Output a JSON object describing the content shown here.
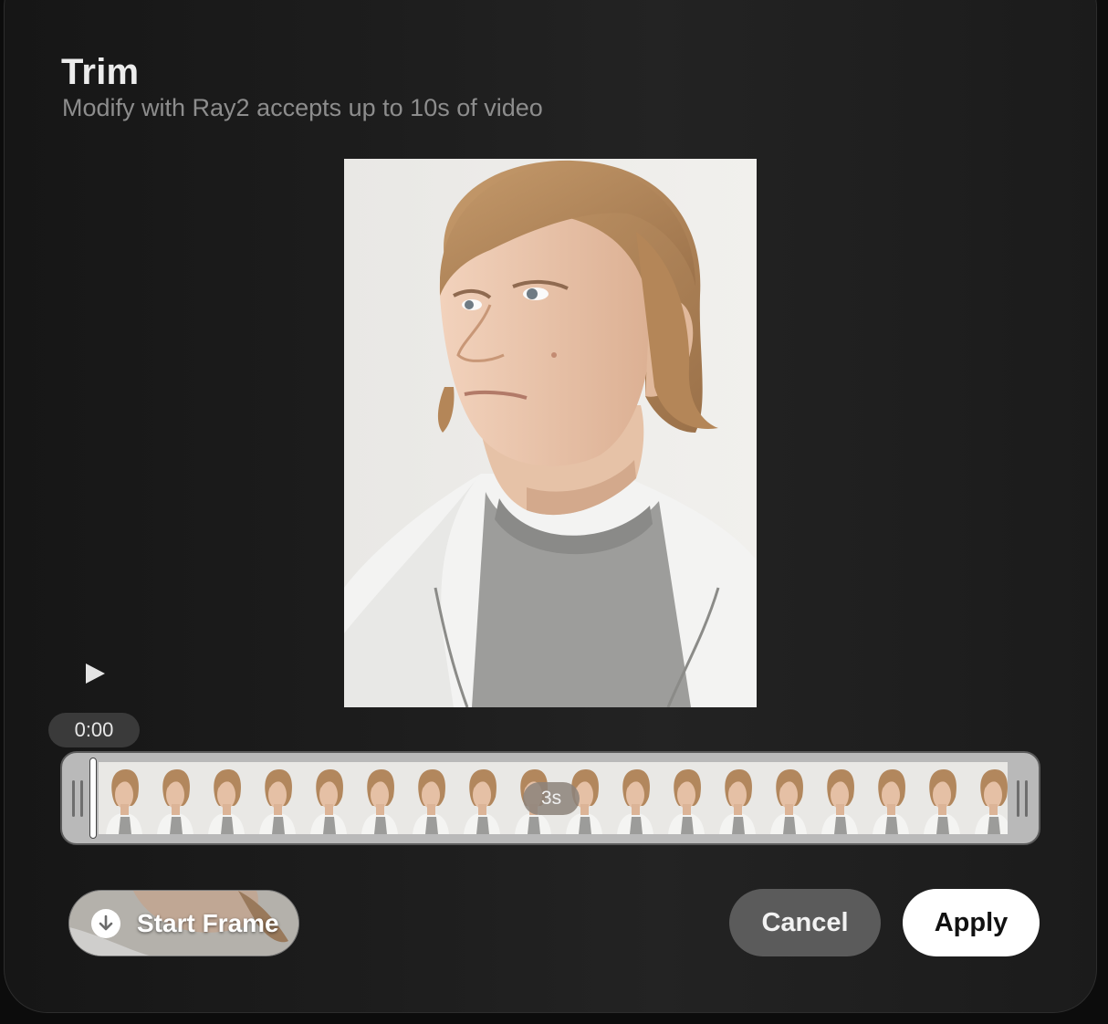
{
  "dialog": {
    "title": "Trim",
    "subtitle": "Modify with Ray2 accepts up to 10s of video"
  },
  "player": {
    "current_time": "0:00",
    "play_icon": "play-icon"
  },
  "timeline": {
    "duration_label": "3s",
    "frame_count": 18
  },
  "actions": {
    "start_frame_label": "Start Frame",
    "start_frame_icon": "download-icon",
    "cancel_label": "Cancel",
    "apply_label": "Apply"
  },
  "colors": {
    "dialog_bg": "#1d1d1d",
    "cancel_bg": "#5b5b5b",
    "apply_bg": "#ffffff",
    "timeline_bg": "#b9b9b9"
  }
}
